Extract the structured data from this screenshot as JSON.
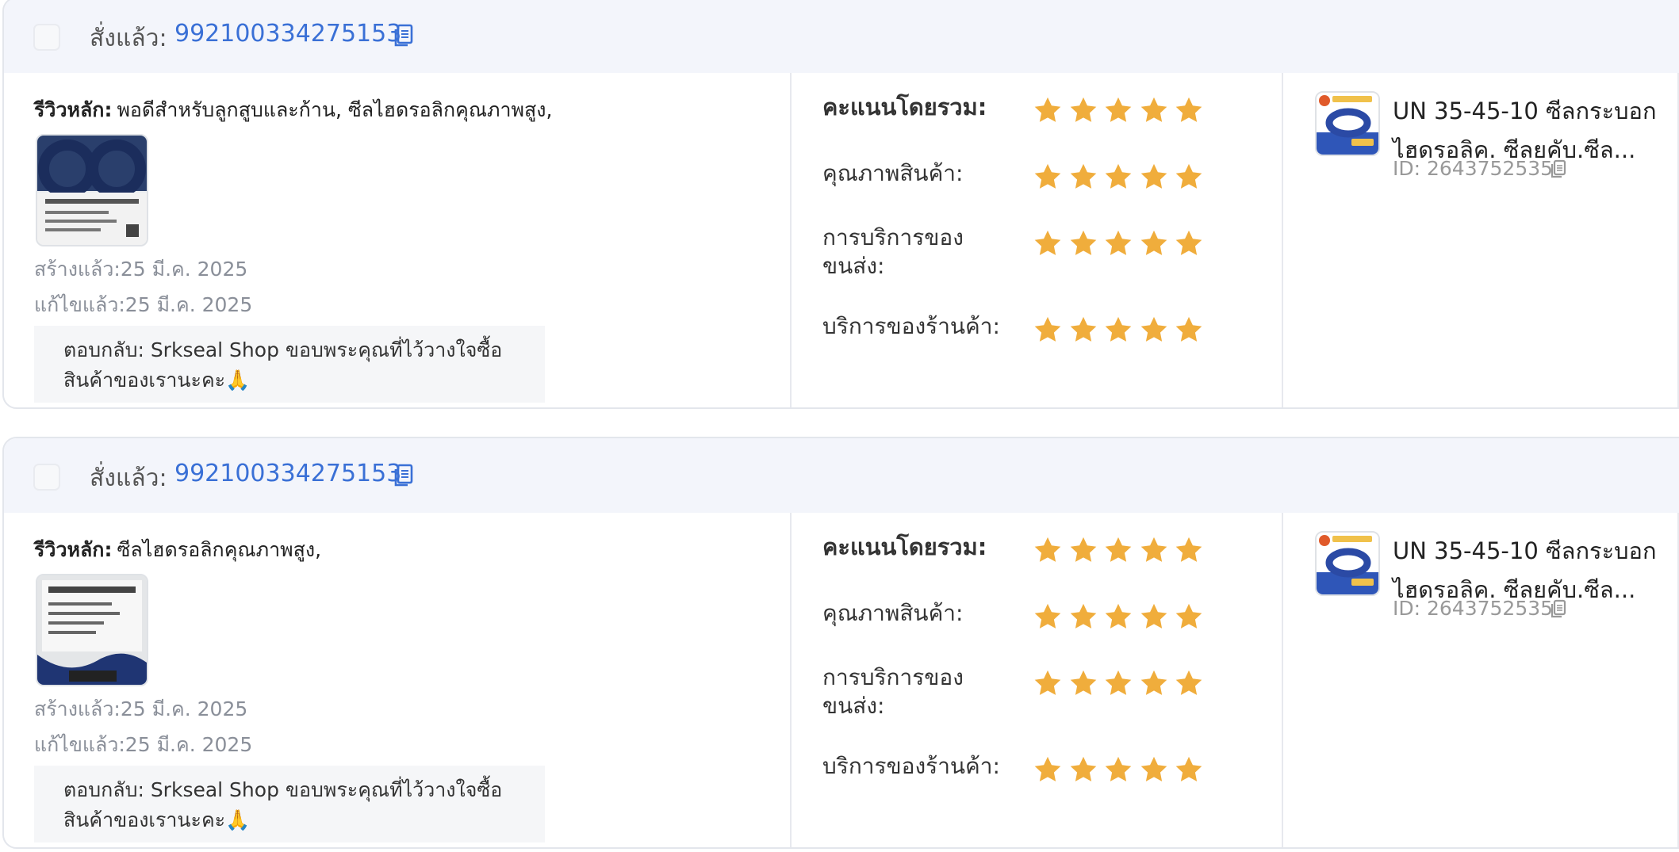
{
  "reviews": [
    {
      "order_label": "สั่งแล้ว:",
      "order_number": "992100334275153",
      "main_review_label": "รีวิวหลัก:",
      "main_review_text": "พอดีสำหรับลูกสูบและก้าน, ซีลไฮดรอลิกคุณภาพสูง,",
      "photo_icon": "product-photo-seal",
      "created_label": "สร้างแล้ว:25 มี.ค. 2025",
      "edited_label": "แก้ไขแล้ว:25 มี.ค. 2025",
      "reply_text": "ตอบกลับ: Srkseal Shop ขอบพระคุณที่ไว้วางใจซื้อสินค้าของเรานะคะ🙏",
      "ratings": [
        {
          "label": "คะแนนโดยรวม:",
          "stars": 5
        },
        {
          "label": "คุณภาพสินค้า:",
          "stars": 5
        },
        {
          "label": "การบริการของขนส่ง:",
          "stars": 5
        },
        {
          "label": "บริการของร้านค้า:",
          "stars": 5
        }
      ],
      "product_title": "UN 35-45-10 ซีลกระบอกไฮดรอลิค. ซีลยคับ.ซีล...",
      "product_id": "ID: 2643752535"
    },
    {
      "order_label": "สั่งแล้ว:",
      "order_number": "992100334275153",
      "main_review_label": "รีวิวหลัก:",
      "main_review_text": "ซีลไฮดรอลิกคุณภาพสูง,",
      "photo_icon": "product-photo-seal-label",
      "created_label": "สร้างแล้ว:25 มี.ค. 2025",
      "edited_label": "แก้ไขแล้ว:25 มี.ค. 2025",
      "reply_text": "ตอบกลับ: Srkseal Shop ขอบพระคุณที่ไว้วางใจซื้อสินค้าของเรานะคะ🙏",
      "ratings": [
        {
          "label": "คะแนนโดยรวม:",
          "stars": 5
        },
        {
          "label": "คุณภาพสินค้า:",
          "stars": 5
        },
        {
          "label": "การบริการของขนส่ง:",
          "stars": 5
        },
        {
          "label": "บริการของร้านค้า:",
          "stars": 5
        }
      ],
      "product_title": "UN 35-45-10 ซีลกระบอกไฮดรอลิค. ซีลยคับ.ซีล...",
      "product_id": "ID: 2643752535"
    }
  ],
  "colors": {
    "accent_blue": "#3a70d6",
    "star_gold": "#f0ad3c",
    "header_bg": "#f3f5fb"
  }
}
